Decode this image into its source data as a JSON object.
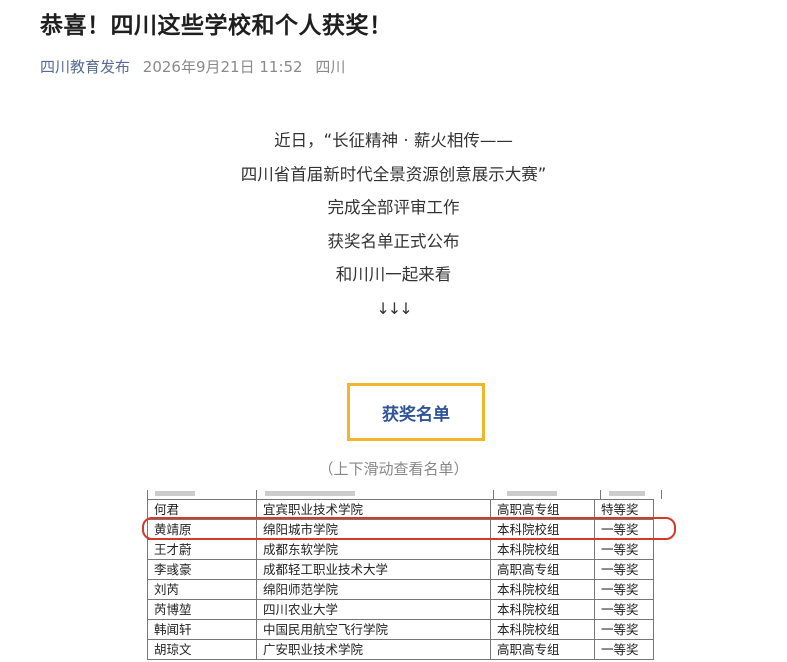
{
  "article": {
    "title": "恭喜！四川这些学校和个人获奖！",
    "account": "四川教育发布",
    "date": "2026年9月21日 11:52",
    "region": "四川"
  },
  "intro_lines": [
    "近日，“长征精神 · 薪火相传——",
    "四川省首届新时代全景资源创意展示大赛”",
    "完成全部评审工作",
    "获奖名单正式公布",
    "和川川一起来看",
    "↓↓↓"
  ],
  "award_list_label": "获奖名单",
  "scroll_hint": "（上下滑动查看名单）",
  "winners_table": {
    "rows": [
      {
        "name": "何君",
        "school": "宜宾职业技术学院",
        "group": "高职高专组",
        "award": "特等奖"
      },
      {
        "name": "黄靖原",
        "school": "绵阳城市学院",
        "group": "本科院校组",
        "award": "一等奖"
      },
      {
        "name": "王才蔚",
        "school": "成都东软学院",
        "group": "本科院校组",
        "award": "一等奖"
      },
      {
        "name": "李彧豪",
        "school": "成都轻工职业技术大学",
        "group": "高职高专组",
        "award": "一等奖"
      },
      {
        "name": "刘芮",
        "school": "绵阳师范学院",
        "group": "本科院校组",
        "award": "一等奖"
      },
      {
        "name": "芮博堃",
        "school": "四川农业大学",
        "group": "本科院校组",
        "award": "一等奖"
      },
      {
        "name": "韩闻轩",
        "school": "中国民用航空飞行学院",
        "group": "本科院校组",
        "award": "一等奖"
      },
      {
        "name": "胡琼文",
        "school": "广安职业技术学院",
        "group": "高职高专组",
        "award": "一等奖"
      }
    ],
    "highlighted_row": 1
  },
  "colors": {
    "account_link": "#576b95",
    "award_box_border": "#f1b52b",
    "award_box_text": "#2f5597",
    "highlight": "#d23a2a"
  }
}
